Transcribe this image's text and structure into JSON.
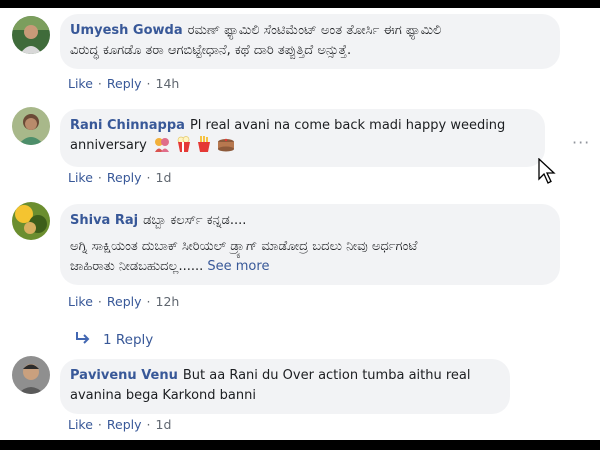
{
  "comments": [
    {
      "author": "Umyesh Gowda",
      "text_line1": "ರಮಣ್ ಫ್ಯಾಮಿಲಿ ಸೆಂಟಿಮೆಂಟ್ ಅಂತ ತೋರ್ಸಿ ಈಗ ಫ್ಯಾಮಿಲಿ",
      "text_line2": "ವಿರುದ್ಧ ಕೂಗಡೊ ತರಾ ಆಗಬಿಟ್ಟೇಧಾನೆ, ಕಥೆ ದಾರಿ ತಪ್ಪುತ್ತಿದೆ ಅನ್ಸುತ್ತೆ.",
      "like": "Like",
      "reply": "Reply",
      "time": "14h"
    },
    {
      "author": "Rani Chinnappa",
      "text_line1": "Pl real avani na come back madi happy weeding",
      "text_line2": "anniversary",
      "like": "Like",
      "reply": "Reply",
      "time": "1d"
    },
    {
      "author": "Shiva Raj",
      "text_line1": "ಡಬ್ಬಾ ಕಲರ್ಸ್ ಕನ್ನಡ....",
      "text_line2": "ಅಗ್ನಿ ಸಾಕ್ಷಿಯಂತ ದುಬಾಕ್ ಸೀರಿಯಲ್ ಡ್ರ್ಯಾಗ್ ಮಾಡೋದ್ರ ಬದಲು ನೀವು ಅರ್ಧಗಂಟೆ",
      "text_line3": "ಜಾಹಿರಾತು ನೀಡಬಹುದಲ್ಲ......",
      "see_more": "See more",
      "like": "Like",
      "reply": "Reply",
      "time": "12h",
      "replies_link": "1 Reply"
    },
    {
      "author": "Pavivenu Venu",
      "text_line1": "But aa Rani du Over action tumba aithu real",
      "text_line2": "avanina bega Karkond banni",
      "like": "Like",
      "reply": "Reply",
      "time": "1d"
    }
  ],
  "colors": {
    "link": "#385898",
    "bubble": "#f2f3f5",
    "meta": "#606770"
  },
  "icons": {
    "more": "more-options-icon",
    "cursor": "mouse-cursor-icon",
    "reply_arrow": "reply-arrow-icon"
  }
}
